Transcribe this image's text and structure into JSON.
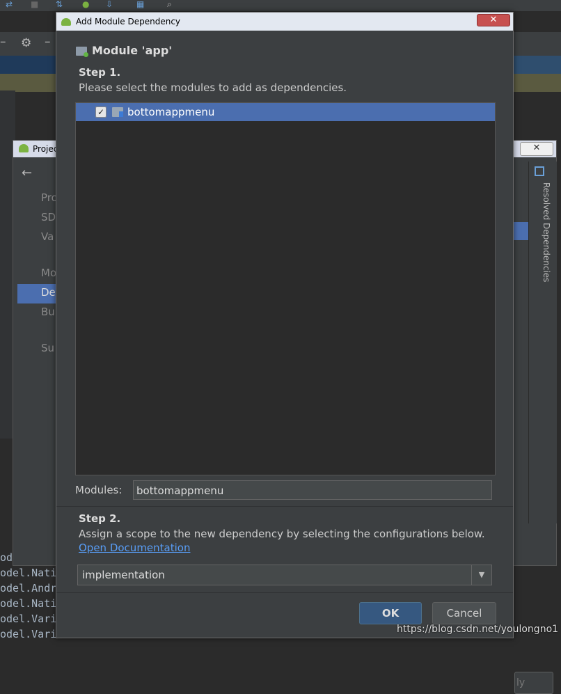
{
  "dialog": {
    "title": "Add Module Dependency",
    "module_header": "Module 'app'",
    "step1": {
      "label": "Step 1.",
      "description": "Please select the modules to add as dependencies."
    },
    "modules_list": [
      {
        "name": "bottomappmenu",
        "checked": true,
        "selected": true
      }
    ],
    "modules_field": {
      "label": "Modules:",
      "value": "bottomappmenu"
    },
    "step2": {
      "label": "Step 2.",
      "description": "Assign a scope to the new dependency by selecting the configurations below.",
      "link": "Open Documentation"
    },
    "scope_select": {
      "value": "implementation"
    },
    "buttons": {
      "ok": "OK",
      "cancel": "Cancel"
    }
  },
  "background": {
    "project_window_title": "Projec",
    "nav_items": [
      "Pro",
      "SD",
      "Va",
      "Mo",
      "De",
      "Bu",
      "Su"
    ],
    "resolved_panel_label": "Resolved Dependencies",
    "apply_button": "ly",
    "code_lines": [
      "od",
      "odel.Native",
      "odel.Andro",
      "odel.Native",
      "odel.Varia",
      "odel.Varia"
    ]
  },
  "watermark": "https://blog.csdn.net/youlongno1",
  "colors": {
    "accent_selection": "#4b6eaf",
    "dialog_background": "#3c3f41",
    "list_background": "#2b2b2b",
    "link": "#589df6",
    "ok_button": "#365880",
    "close_button": "#c75050"
  }
}
